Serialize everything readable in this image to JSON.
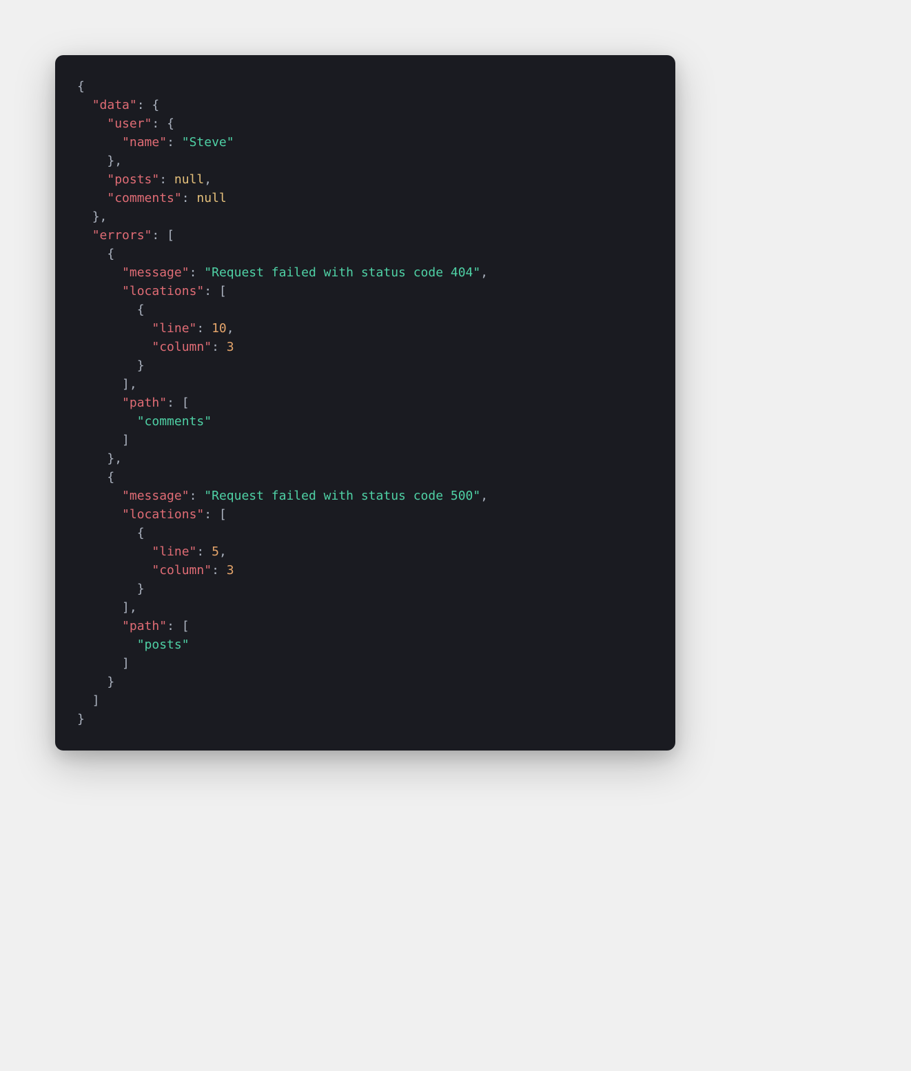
{
  "code": {
    "data": {
      "user": {
        "name": "Steve"
      },
      "posts": null,
      "comments": null
    },
    "errors": [
      {
        "message": "Request failed with status code 404",
        "locations": [
          {
            "line": 10,
            "column": 3
          }
        ],
        "path": [
          "comments"
        ]
      },
      {
        "message": "Request failed with status code 500",
        "locations": [
          {
            "line": 5,
            "column": 3
          }
        ],
        "path": [
          "posts"
        ]
      }
    ]
  },
  "colors": {
    "background": "#1a1b21",
    "punctuation": "#abb2bf",
    "key": "#e06c75",
    "string": "#4fd1a5",
    "null": "#e5c07b",
    "number": "#e5a56b"
  }
}
